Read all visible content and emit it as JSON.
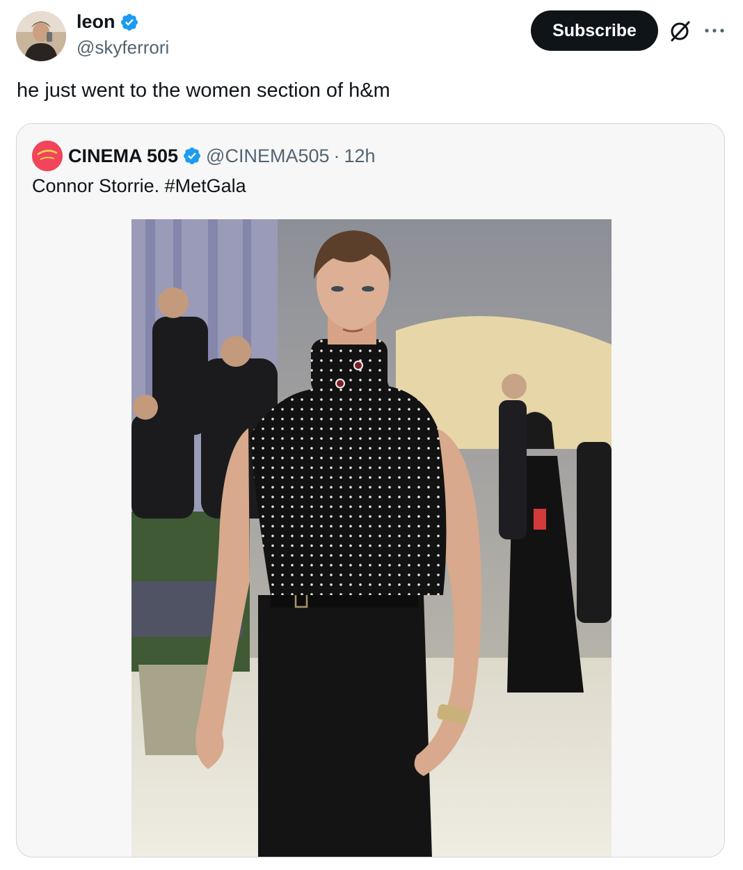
{
  "tweet": {
    "author": {
      "display_name": "leon",
      "handle": "@skyferrori",
      "verified": true
    },
    "subscribe_label": "Subscribe",
    "text": "he just went to the women section of h&m"
  },
  "quoted_tweet": {
    "author": {
      "display_name": "CINEMA 505",
      "handle": "@CINEMA505",
      "verified": true
    },
    "separator": "·",
    "time": "12h",
    "text": "Connor Storrie. #MetGala"
  },
  "colors": {
    "verified": "#1d9bf0",
    "subscribe_bg": "#0f1419",
    "secondary_text": "#536471",
    "card_border": "#cfd9de",
    "cinema_avatar": "#f2445a"
  },
  "icons": [
    "verified-badge-icon",
    "grok-icon",
    "more-icon"
  ]
}
